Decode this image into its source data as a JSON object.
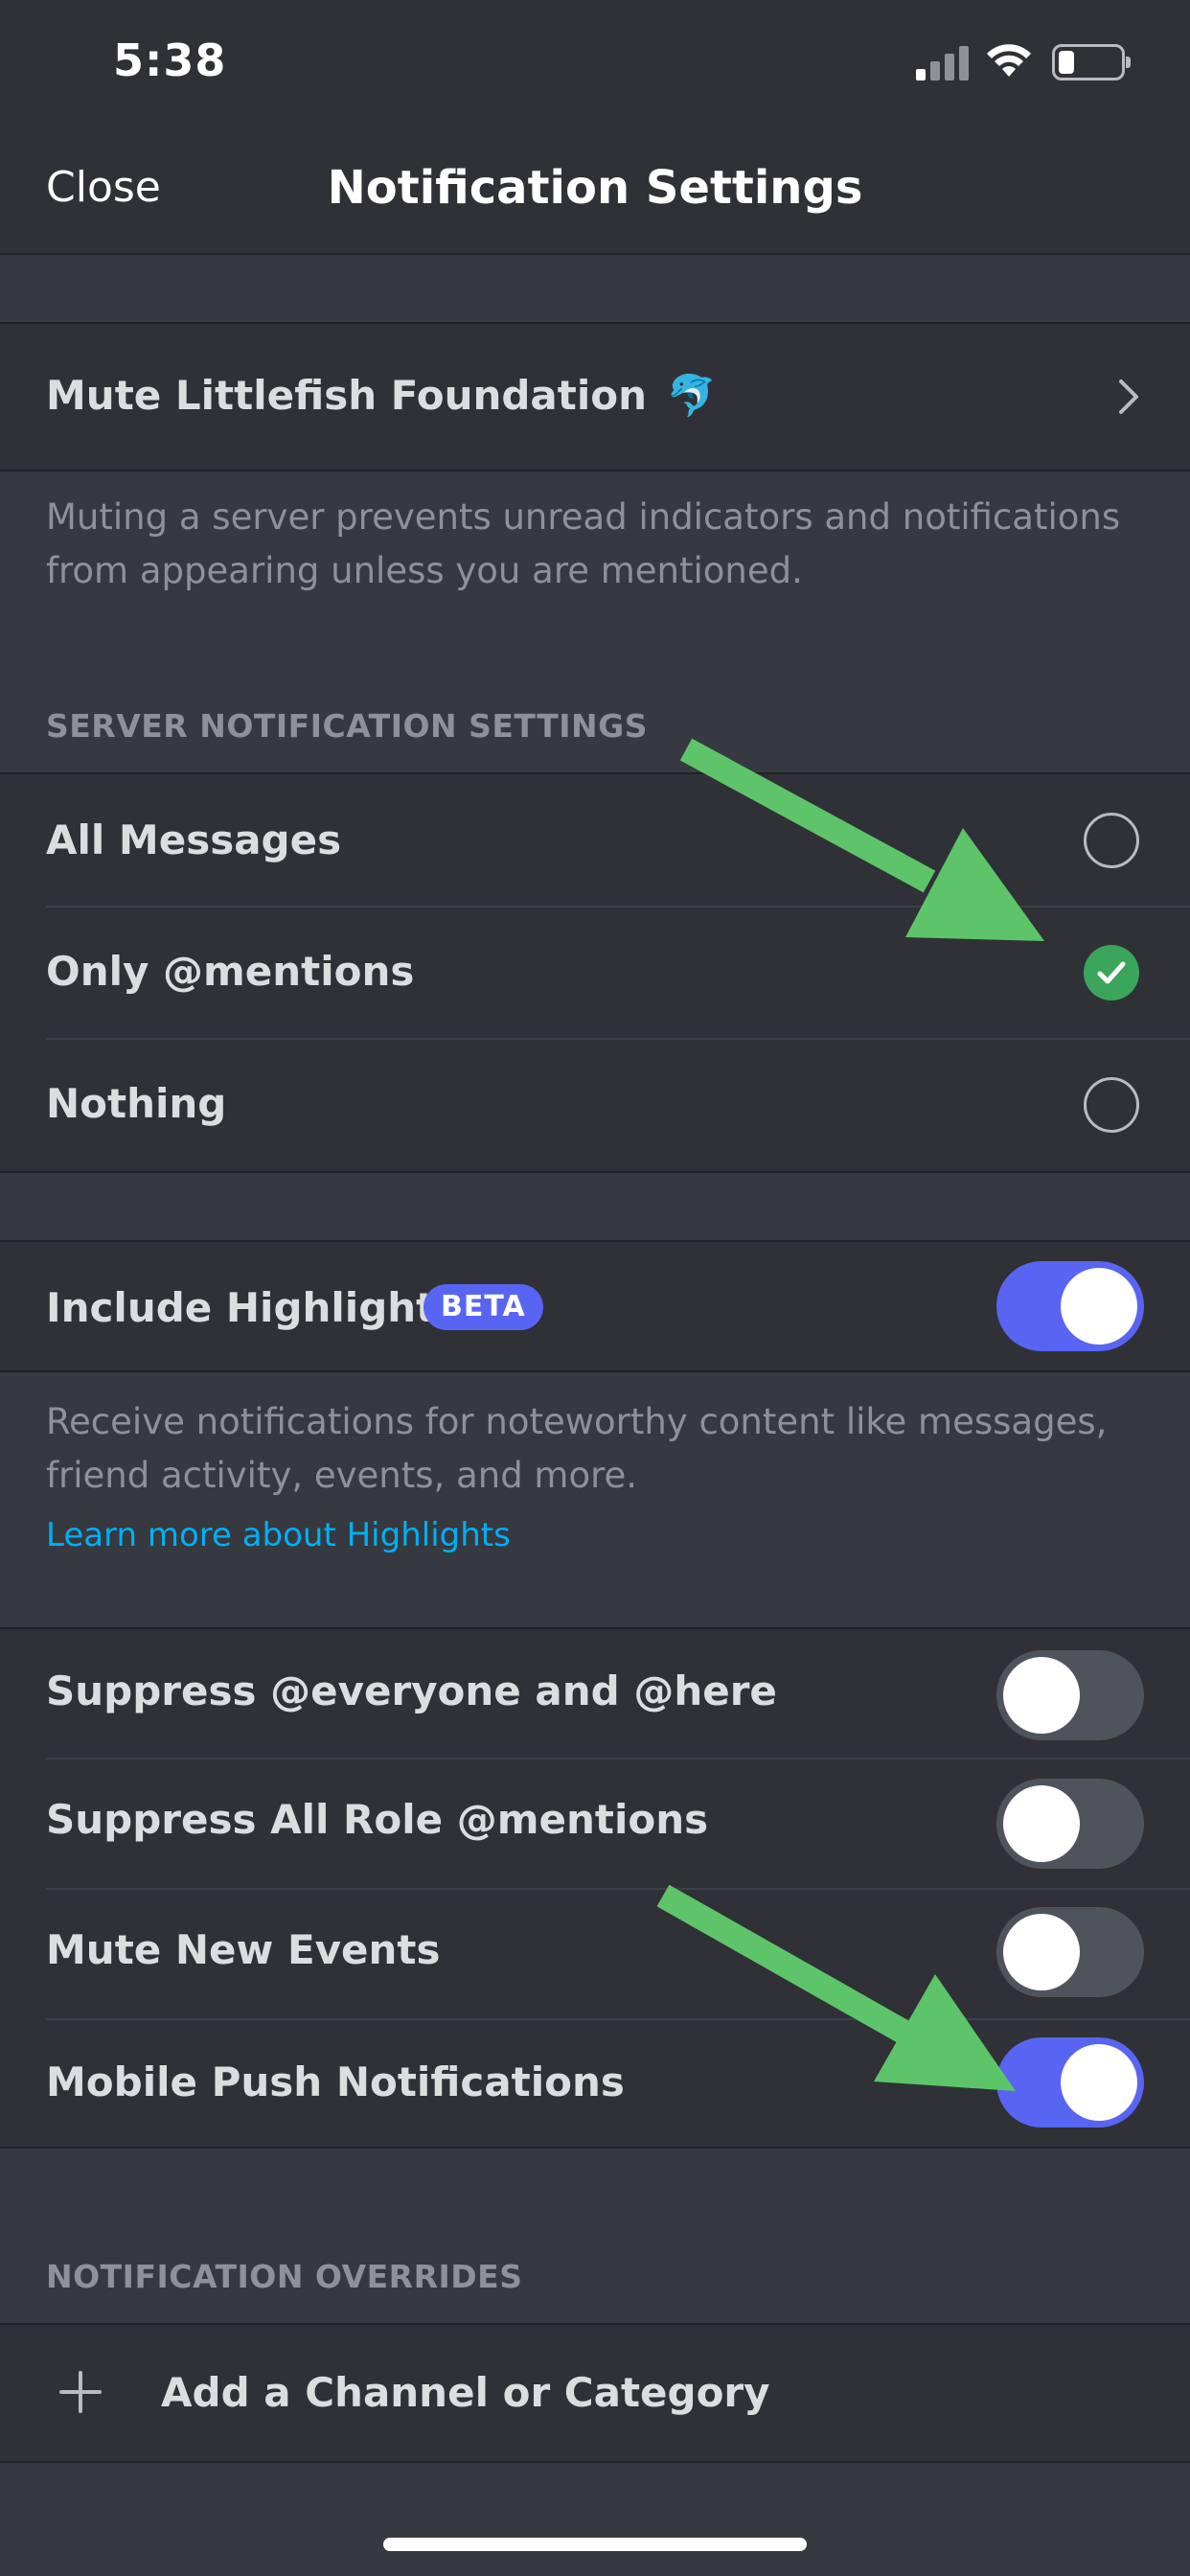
{
  "status_bar": {
    "time": "5:38"
  },
  "header": {
    "close_label": "Close",
    "title": "Notification Settings"
  },
  "mute_row": {
    "label": "Mute Littlefish Foundation",
    "emoji": "🐬"
  },
  "mute_description": {
    "line1": "Muting a server prevents unread indicators and notifications",
    "line2": "from appearing unless you are mentioned."
  },
  "server_notification_settings": {
    "heading": "SERVER NOTIFICATION SETTINGS",
    "options": [
      {
        "label": "All Messages",
        "selected": false
      },
      {
        "label": "Only @mentions",
        "selected": true
      },
      {
        "label": "Nothing",
        "selected": false
      }
    ]
  },
  "highlights": {
    "label": "Include Highlights",
    "badge": "BETA",
    "enabled": true,
    "description_line1": "Receive notifications for noteworthy content like messages,",
    "description_line2": "friend activity, events, and more.",
    "learn_more": "Learn more about Highlights"
  },
  "toggles": [
    {
      "label": "Suppress @everyone and @here",
      "enabled": false
    },
    {
      "label": "Suppress All Role @mentions",
      "enabled": false
    },
    {
      "label": "Mute New Events",
      "enabled": false
    },
    {
      "label": "Mobile Push Notifications",
      "enabled": true
    }
  ],
  "overrides": {
    "heading": "NOTIFICATION OVERRIDES",
    "add_label": "Add a Channel or Category"
  },
  "colors": {
    "background": "#36393f",
    "row": "#2f3136",
    "accent": "#5865f2",
    "success": "#3ba55c",
    "link": "#00aff4",
    "annotation_arrow": "#5ec46a"
  }
}
